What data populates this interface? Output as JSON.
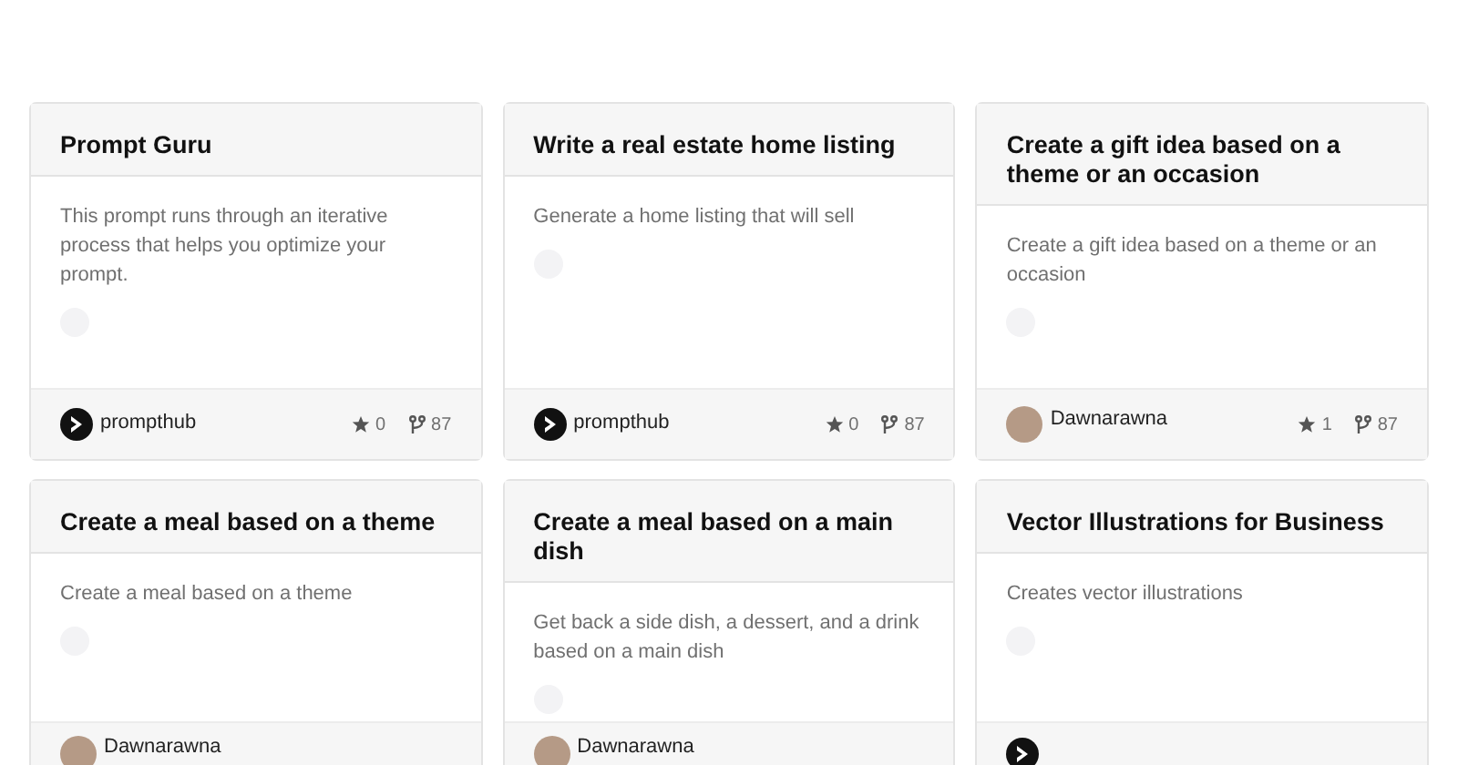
{
  "cards": [
    {
      "title": "Prompt Guru",
      "description": "This prompt runs through an iterative process that helps you optimize your prompt.",
      "author": {
        "name": "prompthub",
        "kind": "logo"
      },
      "stars": "0",
      "forks": "87"
    },
    {
      "title": "Write a real estate home listing",
      "description": "Generate a home listing that will sell",
      "author": {
        "name": "prompthub",
        "kind": "logo"
      },
      "stars": "0",
      "forks": "87"
    },
    {
      "title": "Create a gift idea based on a theme or an occasion",
      "description": "Create a gift idea based on a theme or an occasion",
      "author": {
        "name": "Dawnarawna",
        "kind": "photo"
      },
      "stars": "1",
      "forks": "87"
    },
    {
      "title": "Create a meal based on a theme",
      "description": "Create a meal based on a theme",
      "author": {
        "name": "Dawnarawna",
        "kind": "photo"
      }
    },
    {
      "title": "Create a meal based on a main dish",
      "description": "Get back a side dish, a dessert, and a drink based on a main dish",
      "author": {
        "name": "Dawnarawna",
        "kind": "photo"
      }
    },
    {
      "title": "Vector Illustrations for Business",
      "description": "Creates vector illustrations",
      "author": {
        "kind": "logo"
      }
    }
  ]
}
